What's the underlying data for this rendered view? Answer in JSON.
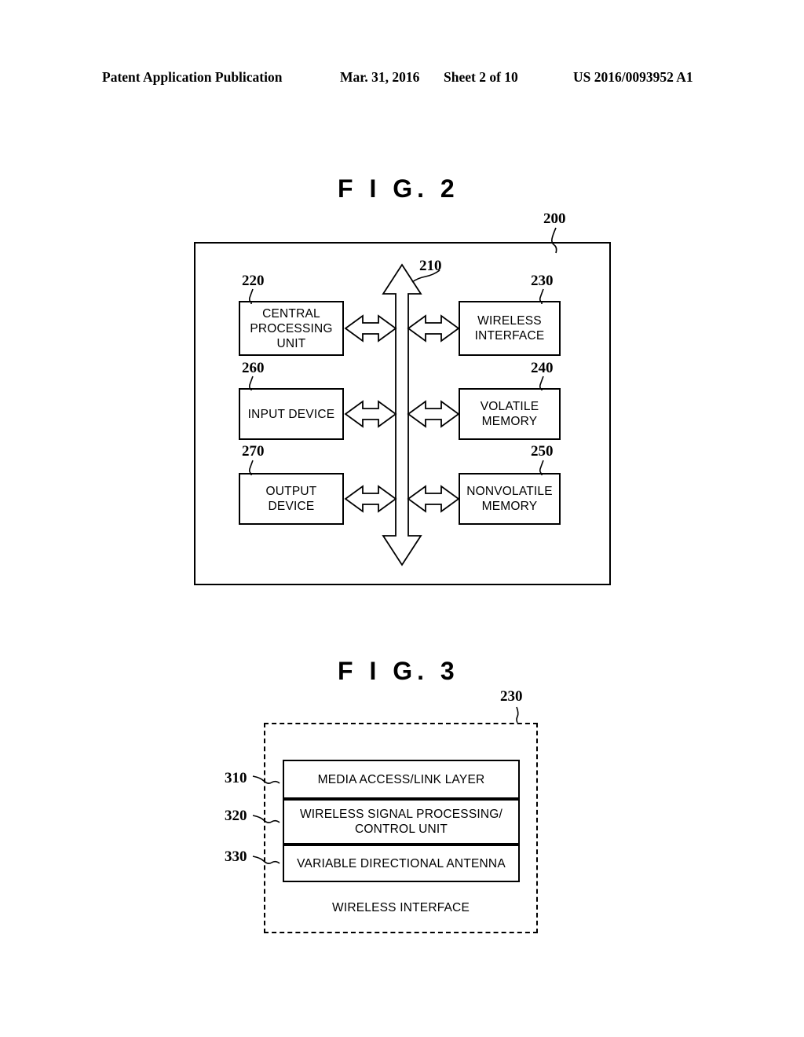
{
  "header": {
    "publication": "Patent Application Publication",
    "date": "Mar. 31, 2016",
    "sheet": "Sheet 2 of 10",
    "doc_number": "US 2016/0093952 A1"
  },
  "figures": [
    {
      "title": "F I G.  2",
      "outer_ref": "200",
      "bus_ref": "210",
      "blocks": [
        {
          "ref": "220",
          "label": "CENTRAL\nPROCESSING\nUNIT"
        },
        {
          "ref": "230",
          "label": "WIRELESS\nINTERFACE"
        },
        {
          "ref": "260",
          "label": "INPUT DEVICE"
        },
        {
          "ref": "240",
          "label": "VOLATILE\nMEMORY"
        },
        {
          "ref": "270",
          "label": "OUTPUT\nDEVICE"
        },
        {
          "ref": "250",
          "label": "NONVOLATILE\nMEMORY"
        }
      ]
    },
    {
      "title": "F I G.  3",
      "outer_ref": "230",
      "caption": "WIRELESS INTERFACE",
      "layers": [
        {
          "ref": "310",
          "label": "MEDIA ACCESS/LINK LAYER"
        },
        {
          "ref": "320",
          "label": "WIRELESS SIGNAL PROCESSING/\nCONTROL UNIT"
        },
        {
          "ref": "330",
          "label": "VARIABLE DIRECTIONAL ANTENNA"
        }
      ]
    }
  ]
}
